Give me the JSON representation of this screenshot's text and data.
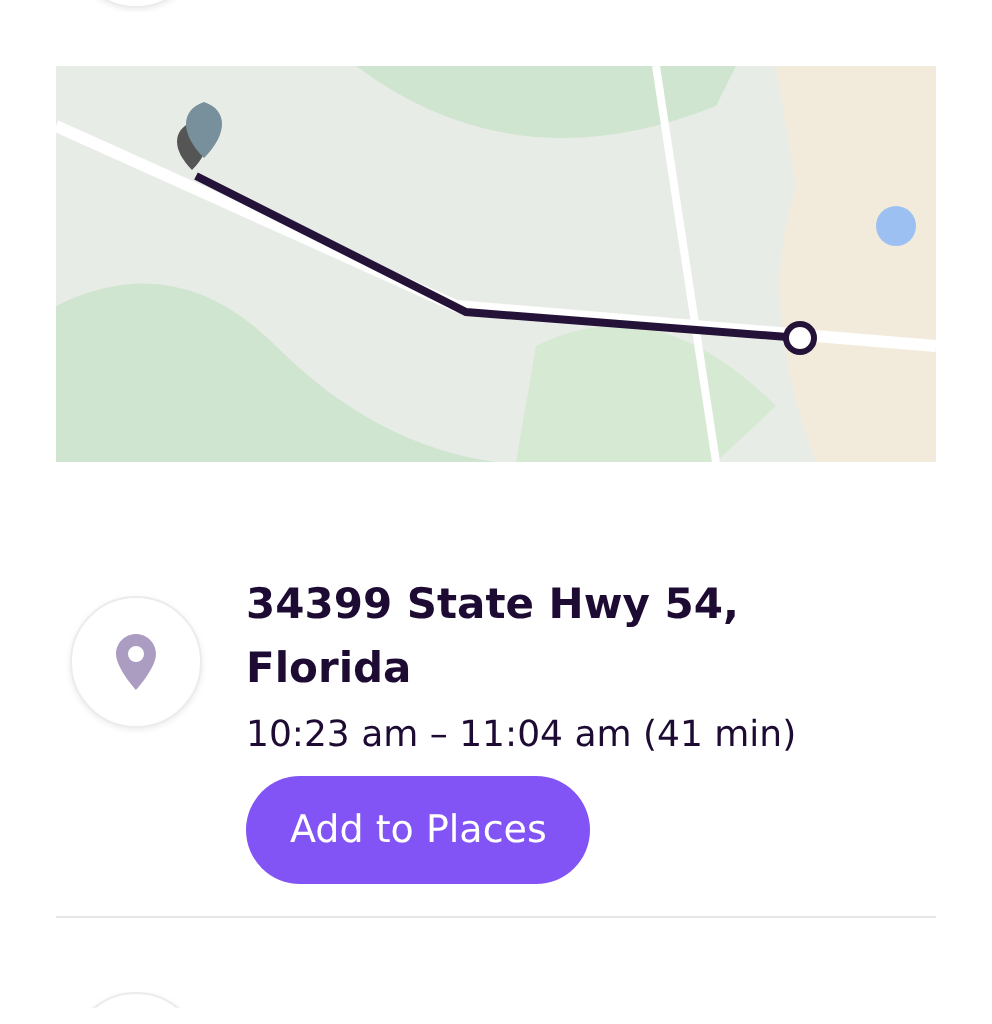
{
  "stop": {
    "address": "34399 State Hwy 54, Florida",
    "time": "10:23 am – 11:04 am (41 min)",
    "button": "Add to Places"
  }
}
